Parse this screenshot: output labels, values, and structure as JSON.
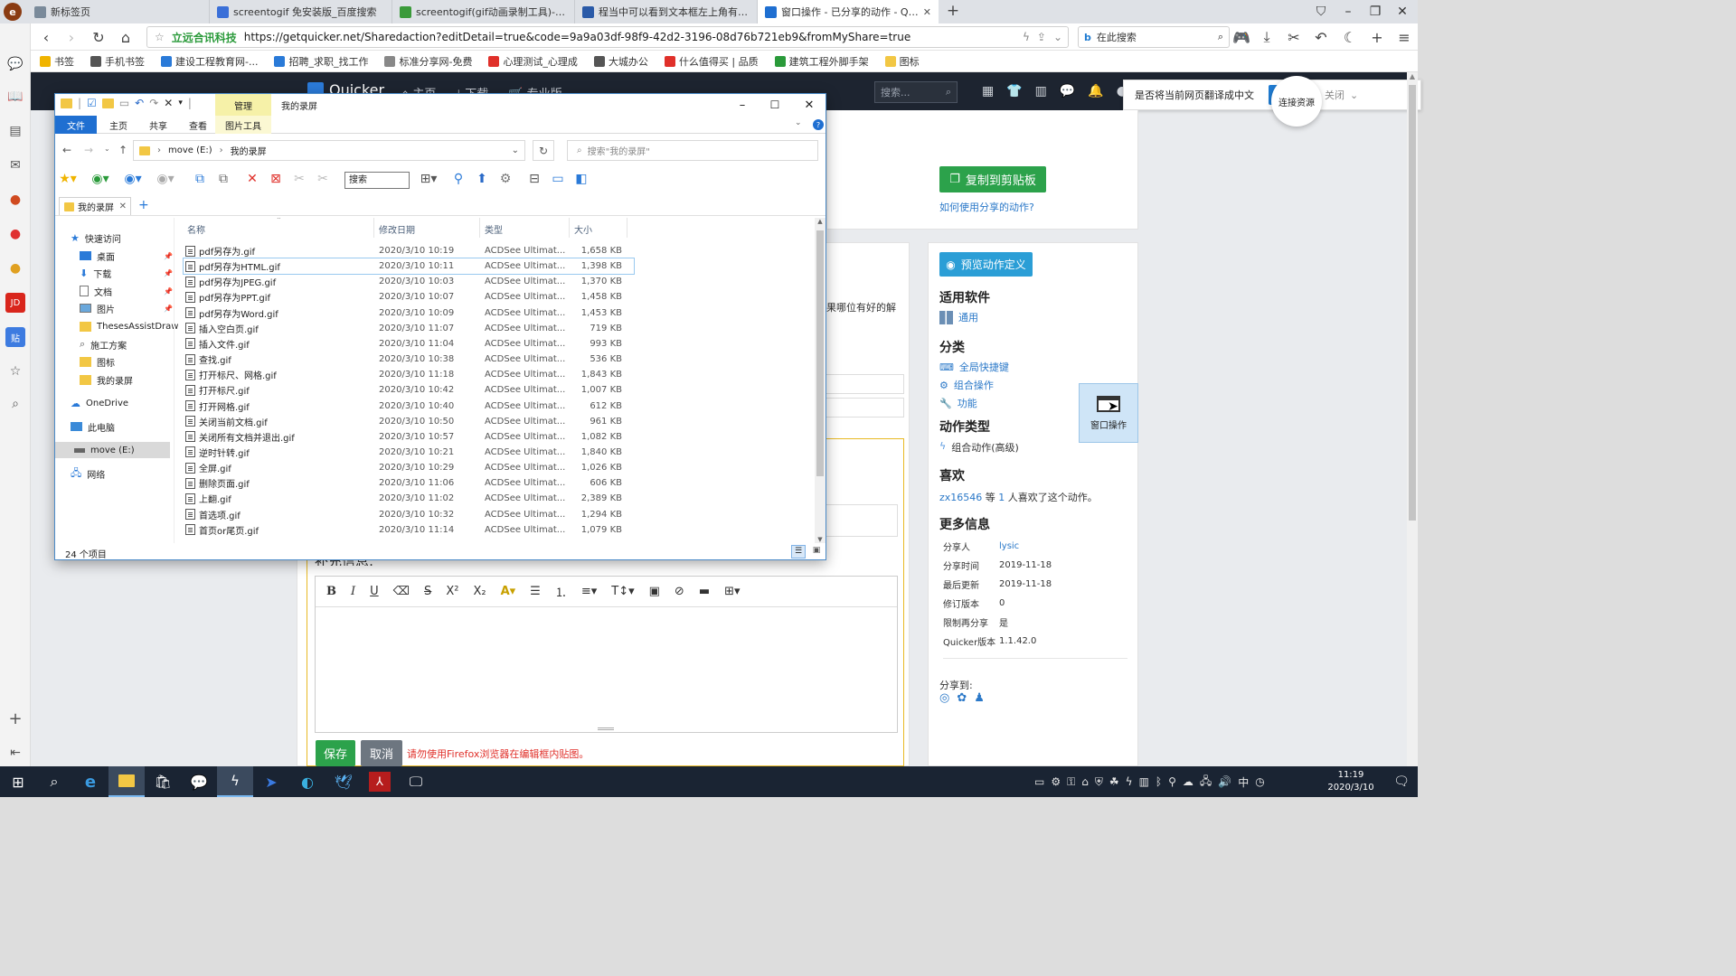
{
  "browser": {
    "tabs": [
      {
        "label": "新标签页",
        "color": "#7a8a9a"
      },
      {
        "label": "screentogif 免安装版_百度搜索",
        "color": "#3a6fd8"
      },
      {
        "label": "screentogif(gif动画录制工具)-Scree",
        "color": "#3a9a3a"
      },
      {
        "label": "程当中可以看到文本框左上角有帧数",
        "color": "#2a5aa8"
      },
      {
        "label": "窗口操作 - 已分享的动作 - Quicker",
        "color": "#1f6fd1"
      }
    ],
    "site_badge": "立远合讯科技",
    "url": "https://getquicker.net/Sharedaction?editDetail=true&code=9a9a03df-98f9-42d2-3196-08d76b721eb9&fromMyShare=true",
    "search_placeholder": "在此搜索",
    "bookmarks": [
      "书签",
      "手机书签",
      "建设工程教育网-...",
      "招聘_求职_找工作",
      "标准分享网-免费",
      "心理测试_心理成",
      "大城办公",
      "什么值得买 | 品质",
      "建筑工程外脚手架",
      "图标"
    ],
    "translate_prompt": "是否将当前网页翻译成中文",
    "translate_close": "关闭",
    "connect_resource": "连接资源"
  },
  "site": {
    "logo": "Quicker",
    "nav": [
      "主页",
      "下载",
      "专业版"
    ],
    "search_placeholder": "搜索..."
  },
  "page": {
    "copy_button": "复制到剪贴板",
    "how_to_link": "如何使用分享的动作?",
    "preview_button": "预览动作定义",
    "fragment_text": "果哪位有好的解",
    "software_heading": "适用软件",
    "software_value": "通用",
    "category_heading": "分类",
    "categories": [
      "全局快捷键",
      "组合操作",
      "功能"
    ],
    "action_type_heading": "动作类型",
    "action_type_value": "组合动作(高级)",
    "likes_heading": "喜欢",
    "likes_user": "zx16546",
    "likes_text_pre": "等",
    "likes_count": "1",
    "likes_text_post": "人喜欢了这个动作。",
    "more_info_heading": "更多信息",
    "more_info": [
      {
        "k": "分享人",
        "v": "lysic"
      },
      {
        "k": "分享时间",
        "v": "2019-11-18"
      },
      {
        "k": "最后更新",
        "v": "2019-11-18"
      },
      {
        "k": "修订版本",
        "v": "0"
      },
      {
        "k": "限制再分享",
        "v": "是"
      },
      {
        "k": "Quicker版本",
        "v": "1.1.42.0"
      }
    ],
    "share_to": "分享到:",
    "supplement_label": "补充信息:",
    "save_button": "保存",
    "cancel_button": "取消",
    "warning": "请勿使用Firefox浏览器在编辑框内贴图。",
    "floating_action_label": "窗口操作"
  },
  "explorer": {
    "title": "我的录屏",
    "context_tab": "管理",
    "context_subtab": "图片工具",
    "ribbon_tabs": [
      "文件",
      "主页",
      "共享",
      "查看"
    ],
    "breadcrumb": [
      "move (E:)",
      "我的录屏"
    ],
    "search_placeholder": "搜索\"我的录屏\"",
    "toolbar_search": "搜索",
    "doc_tab": "我的录屏",
    "columns": [
      "名称",
      "修改日期",
      "类型",
      "大小"
    ],
    "nav": [
      {
        "label": "快速访问",
        "icon": "star",
        "indent": 0
      },
      {
        "label": "桌面",
        "icon": "desktop",
        "indent": 1,
        "pin": true
      },
      {
        "label": "下载",
        "icon": "download",
        "indent": 1,
        "pin": true
      },
      {
        "label": "文档",
        "icon": "doc",
        "indent": 1,
        "pin": true
      },
      {
        "label": "图片",
        "icon": "picture",
        "indent": 1,
        "pin": true
      },
      {
        "label": "ThesesAssistDraw",
        "icon": "folder",
        "indent": 1
      },
      {
        "label": "施工方案",
        "icon": "search",
        "indent": 1
      },
      {
        "label": "图标",
        "icon": "folder",
        "indent": 1
      },
      {
        "label": "我的录屏",
        "icon": "folder",
        "indent": 1
      },
      {
        "label": "OneDrive",
        "icon": "cloud",
        "indent": 0
      },
      {
        "label": "此电脑",
        "icon": "pc",
        "indent": 0
      },
      {
        "label": "move (E:)",
        "icon": "drive",
        "indent": 0,
        "selected": true
      },
      {
        "label": "网络",
        "icon": "network",
        "indent": 0
      }
    ],
    "files": [
      {
        "name": "pdf另存为.gif",
        "date": "2020/3/10 10:19",
        "type": "ACDSee Ultimat...",
        "size": "1,658 KB"
      },
      {
        "name": "pdf另存为HTML.gif",
        "date": "2020/3/10 10:11",
        "type": "ACDSee Ultimat...",
        "size": "1,398 KB",
        "focused": true
      },
      {
        "name": "pdf另存为JPEG.gif",
        "date": "2020/3/10 10:03",
        "type": "ACDSee Ultimat...",
        "size": "1,370 KB"
      },
      {
        "name": "pdf另存为PPT.gif",
        "date": "2020/3/10 10:07",
        "type": "ACDSee Ultimat...",
        "size": "1,458 KB"
      },
      {
        "name": "pdf另存为Word.gif",
        "date": "2020/3/10 10:09",
        "type": "ACDSee Ultimat...",
        "size": "1,453 KB"
      },
      {
        "name": "插入空白页.gif",
        "date": "2020/3/10 11:07",
        "type": "ACDSee Ultimat...",
        "size": "719 KB"
      },
      {
        "name": "插入文件.gif",
        "date": "2020/3/10 11:04",
        "type": "ACDSee Ultimat...",
        "size": "993 KB"
      },
      {
        "name": "查找.gif",
        "date": "2020/3/10 10:38",
        "type": "ACDSee Ultimat...",
        "size": "536 KB"
      },
      {
        "name": "打开标尺、网格.gif",
        "date": "2020/3/10 11:18",
        "type": "ACDSee Ultimat...",
        "size": "1,843 KB"
      },
      {
        "name": "打开标尺.gif",
        "date": "2020/3/10 10:42",
        "type": "ACDSee Ultimat...",
        "size": "1,007 KB"
      },
      {
        "name": "打开网格.gif",
        "date": "2020/3/10 10:40",
        "type": "ACDSee Ultimat...",
        "size": "612 KB"
      },
      {
        "name": "关闭当前文档.gif",
        "date": "2020/3/10 10:50",
        "type": "ACDSee Ultimat...",
        "size": "961 KB"
      },
      {
        "name": "关闭所有文档并退出.gif",
        "date": "2020/3/10 10:57",
        "type": "ACDSee Ultimat...",
        "size": "1,082 KB"
      },
      {
        "name": "逆时针转.gif",
        "date": "2020/3/10 10:21",
        "type": "ACDSee Ultimat...",
        "size": "1,840 KB"
      },
      {
        "name": "全屏.gif",
        "date": "2020/3/10 10:29",
        "type": "ACDSee Ultimat...",
        "size": "1,026 KB"
      },
      {
        "name": "删除页面.gif",
        "date": "2020/3/10 11:06",
        "type": "ACDSee Ultimat...",
        "size": "606 KB"
      },
      {
        "name": "上翻.gif",
        "date": "2020/3/10 11:02",
        "type": "ACDSee Ultimat...",
        "size": "2,389 KB"
      },
      {
        "name": "首选项.gif",
        "date": "2020/3/10 10:32",
        "type": "ACDSee Ultimat...",
        "size": "1,294 KB"
      },
      {
        "name": "首页or尾页.gif",
        "date": "2020/3/10 11:14",
        "type": "ACDSee Ultimat...",
        "size": "1,079 KB"
      }
    ],
    "status": "24 个项目"
  },
  "taskbar": {
    "time": "11:19",
    "date": "2020/3/10",
    "ime": "中"
  }
}
